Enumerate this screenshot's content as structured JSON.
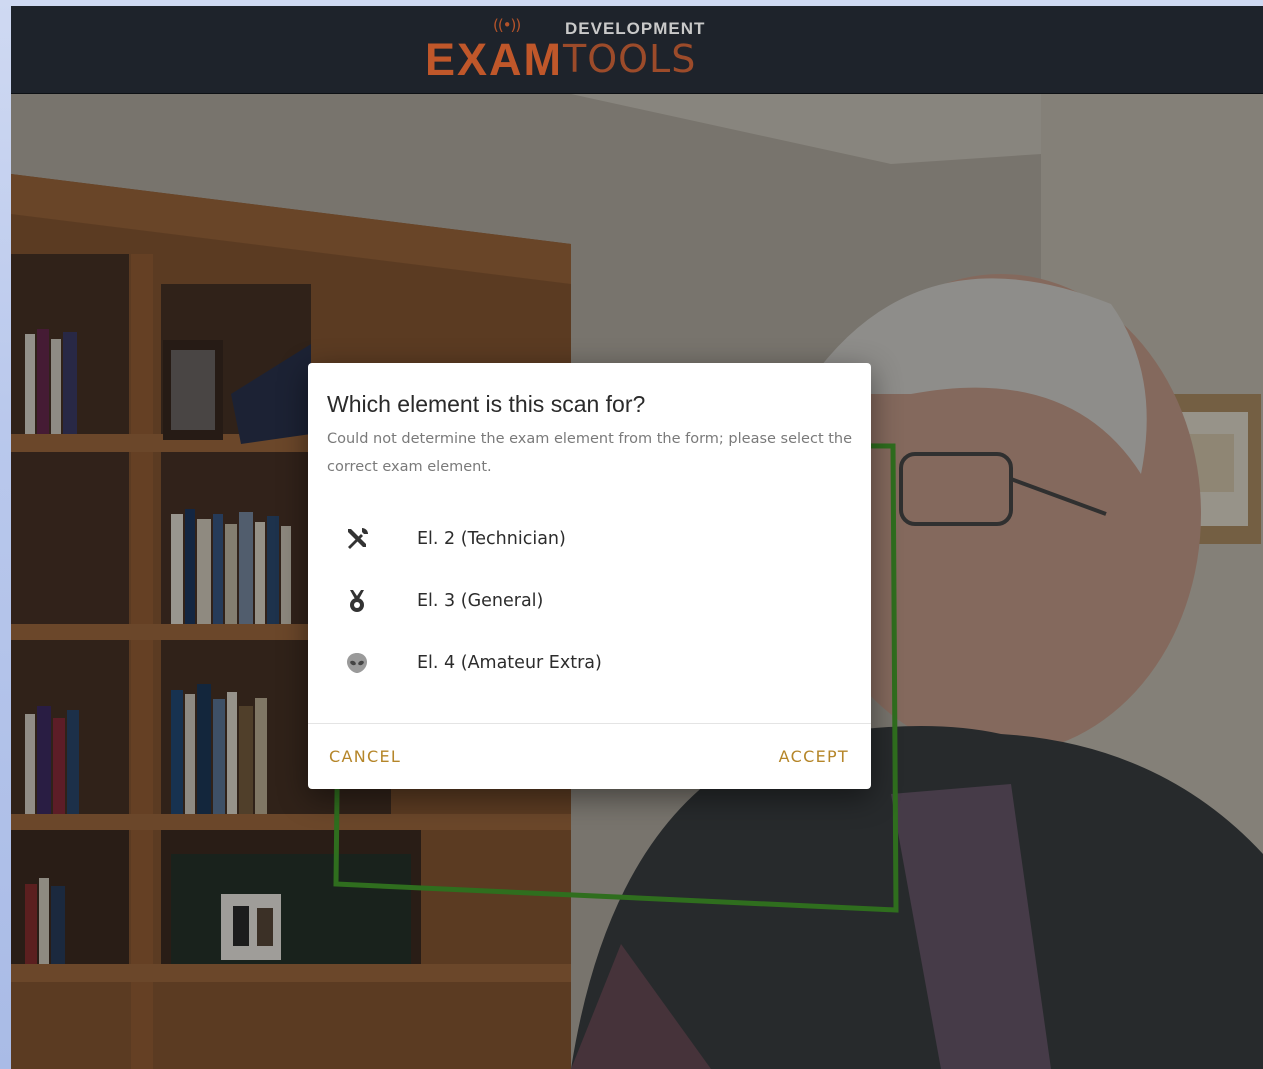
{
  "header": {
    "logo_exam": "EXAM",
    "logo_tools": "TOOLS",
    "logo_dev": "DEVELOPMENT",
    "logo_signal": "((•))"
  },
  "colors": {
    "brand": "#c0572a",
    "header_bg": "#1e232b",
    "accent_button": "#b5862a",
    "scan_frame": "#2f6e1e"
  },
  "dialog": {
    "title": "Which element is this scan for?",
    "subtitle": "Could not determine the exam element from the form; please select the correct exam element.",
    "options": [
      {
        "label": "El. 2 (Technician)",
        "icon": "tools-icon"
      },
      {
        "label": "El. 3 (General)",
        "icon": "medal-icon"
      },
      {
        "label": "El. 4 (Amateur Extra)",
        "icon": "alien-icon"
      }
    ],
    "cancel_label": "CANCEL",
    "accept_label": "ACCEPT"
  }
}
